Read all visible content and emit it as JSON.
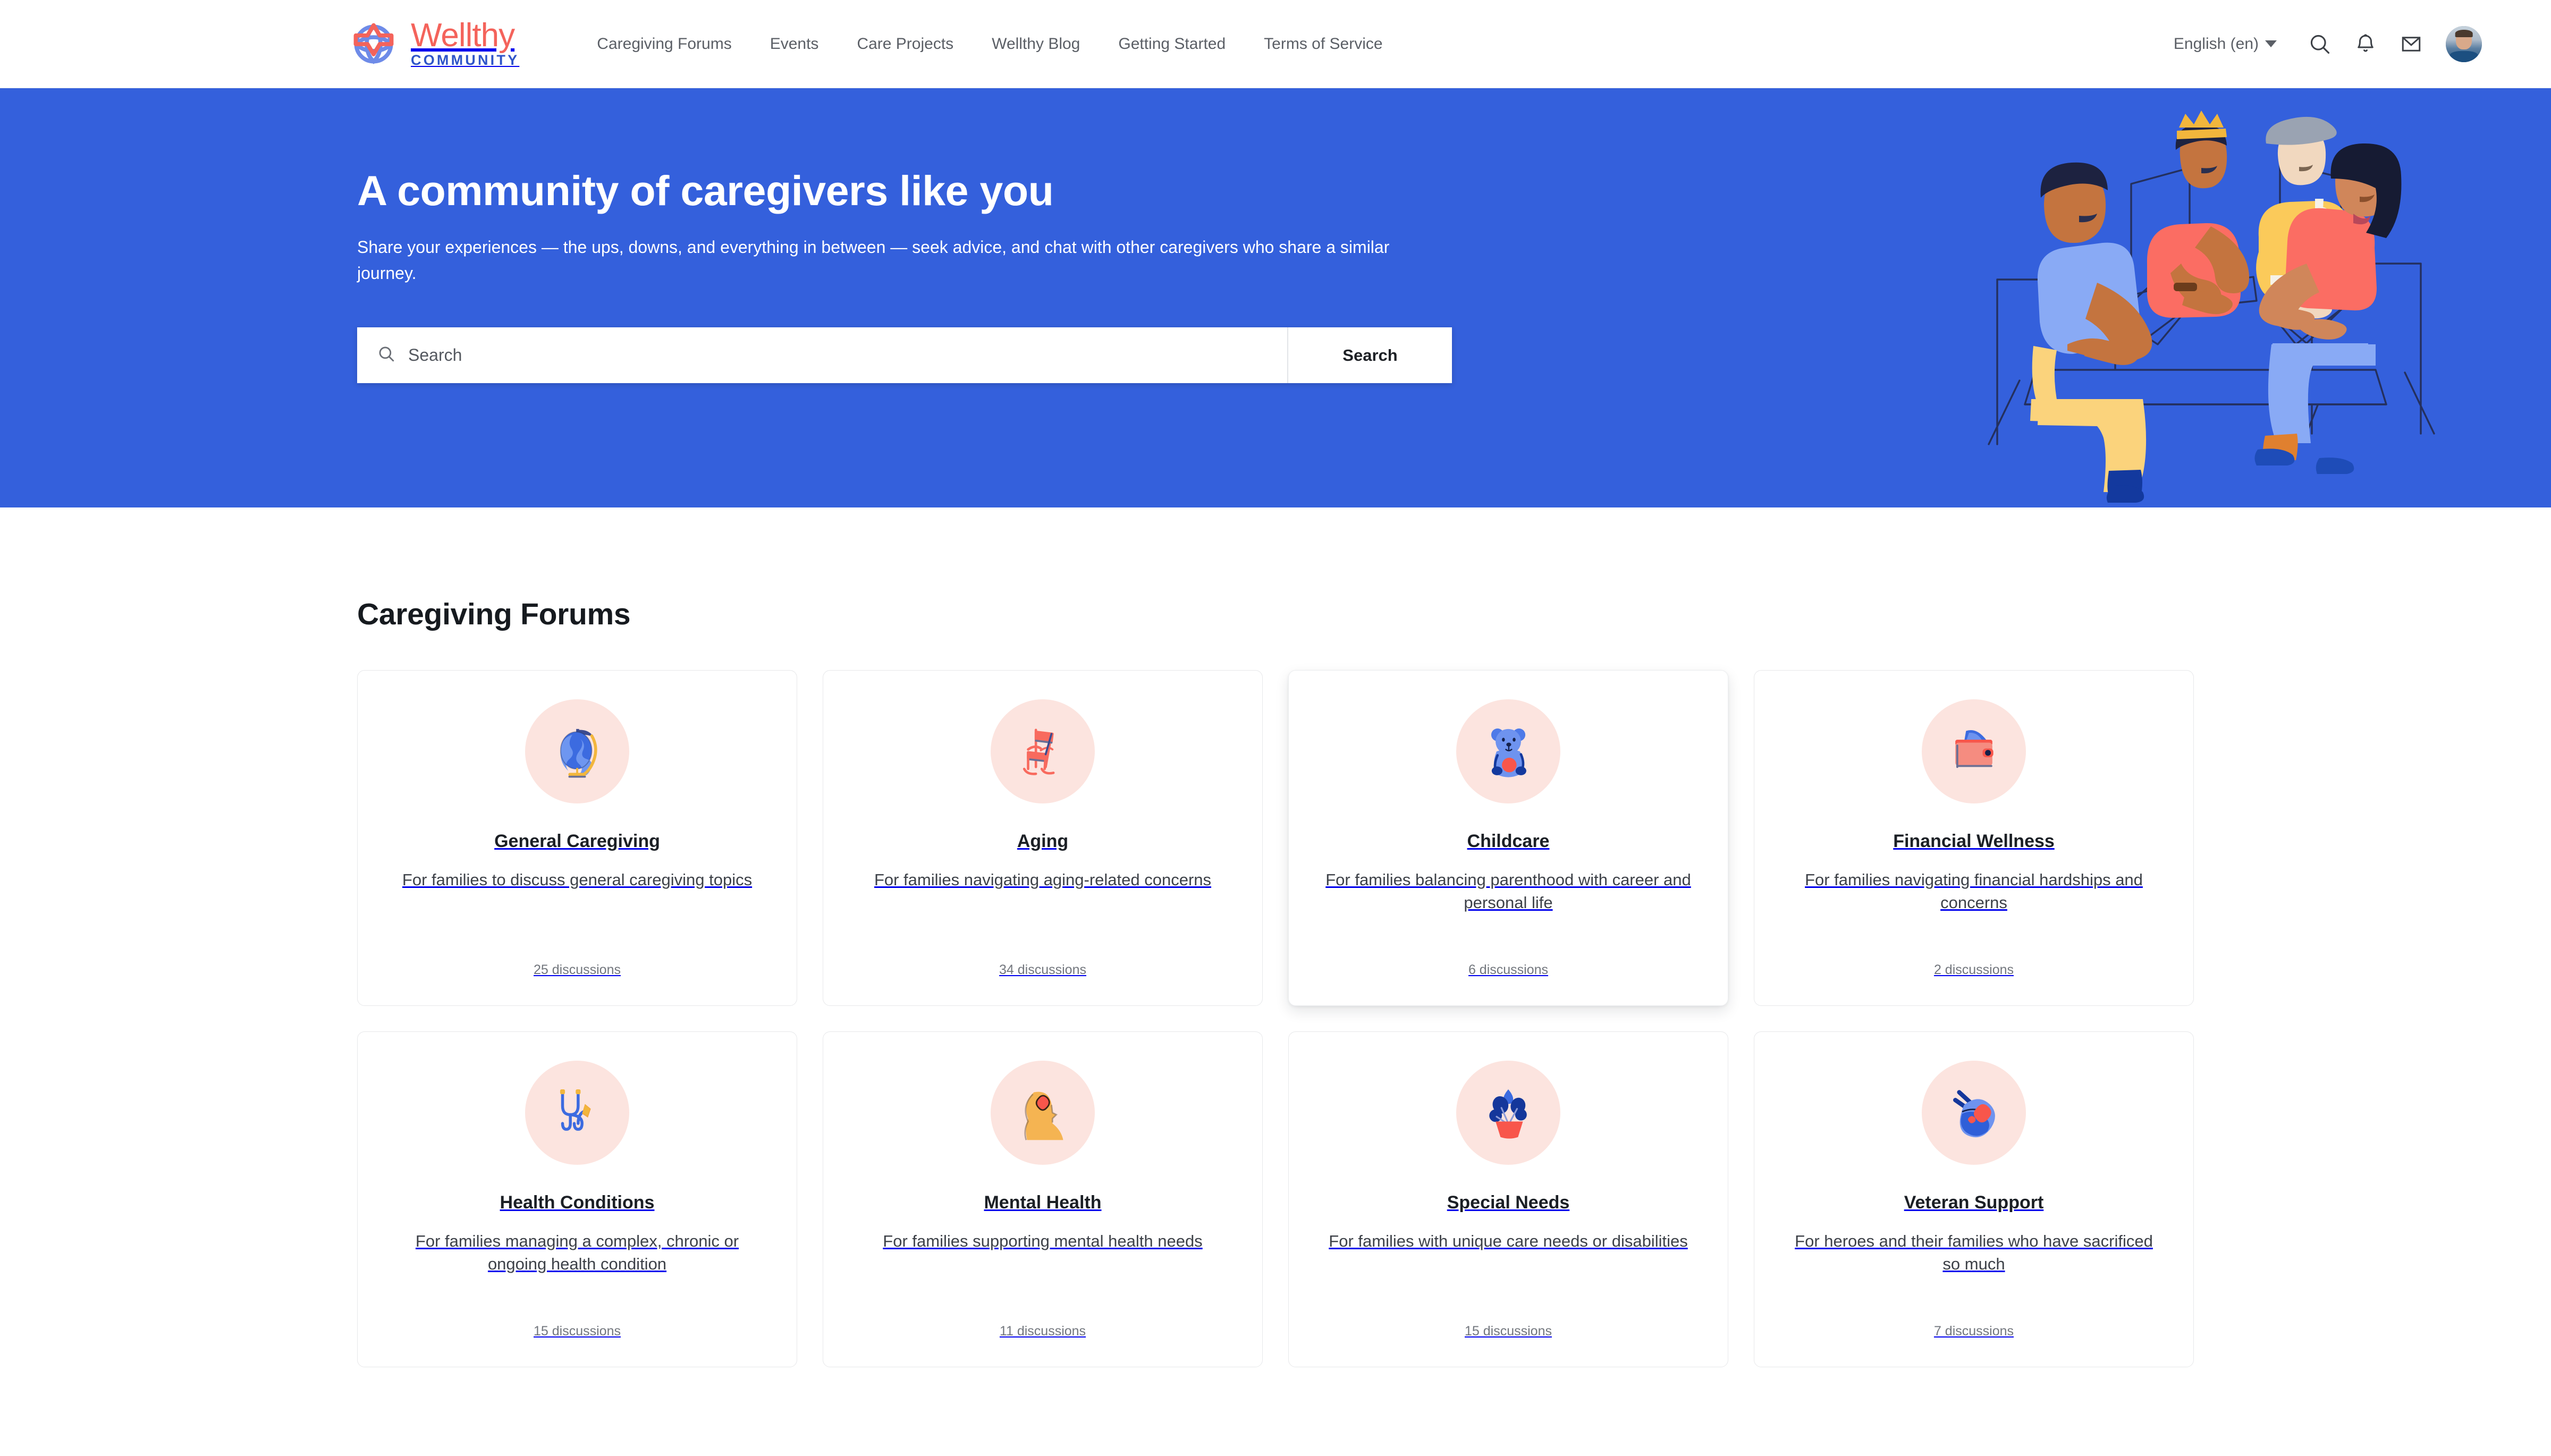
{
  "brand": {
    "name": "Wellthy",
    "sub": "COMMUNITY",
    "logo_icon": "wellthy-star-logo",
    "name_color": "#F4635B",
    "sub_color": "#2E54C8"
  },
  "nav": {
    "items": [
      {
        "label": "Caregiving Forums"
      },
      {
        "label": "Events"
      },
      {
        "label": "Care Projects"
      },
      {
        "label": "Wellthy Blog"
      },
      {
        "label": "Getting Started"
      },
      {
        "label": "Terms of Service"
      }
    ]
  },
  "header_right": {
    "language": "English (en)",
    "language_caret_icon": "chevron-down-icon",
    "search_icon": "search-icon",
    "notifications_icon": "bell-icon",
    "messages_icon": "envelope-icon",
    "avatar_label": "user-avatar"
  },
  "hero": {
    "background_color": "#3460DC",
    "title": "A community of caregivers like you",
    "subtitle": "Share your experiences — the ups, downs, and everything in between — seek advice, and chat with other caregivers who share a similar journey.",
    "search": {
      "placeholder": "Search",
      "value": "",
      "icon": "search-icon",
      "button_label": "Search"
    },
    "illustration": "four-caregivers-at-table-with-laptops"
  },
  "main": {
    "section_title": "Caregiving Forums",
    "icon_bg_color": "#FCE4DF",
    "forums": [
      {
        "title": "General Caregiving",
        "description": "For families to discuss general caregiving topics",
        "count": "25 discussions",
        "icon": "globe-icon",
        "raised": false
      },
      {
        "title": "Aging",
        "description": "For families navigating aging-related concerns",
        "count": "34 discussions",
        "icon": "rocking-chair-icon",
        "raised": false
      },
      {
        "title": "Childcare",
        "description": "For families balancing parenthood with career and personal life",
        "count": "6 discussions",
        "icon": "teddy-bear-icon",
        "raised": true
      },
      {
        "title": "Financial Wellness",
        "description": "For families navigating financial hardships and concerns",
        "count": "2 discussions",
        "icon": "wallet-icon",
        "raised": false
      },
      {
        "title": "Health Conditions",
        "description": "For families managing a complex, chronic or ongoing health condition",
        "count": "15 discussions",
        "icon": "stethoscope-icon",
        "raised": false
      },
      {
        "title": "Mental Health",
        "description": "For families supporting mental health needs",
        "count": "11 discussions",
        "icon": "head-with-heart-icon",
        "raised": false
      },
      {
        "title": "Special Needs",
        "description": "For families with unique care needs or disabilities",
        "count": "15 discussions",
        "icon": "potted-plant-icon",
        "raised": false
      },
      {
        "title": "Veteran Support",
        "description": "For heroes and their families who have sacrificed so much",
        "count": "7 discussions",
        "icon": "dog-tags-heart-icon",
        "raised": false
      }
    ]
  }
}
